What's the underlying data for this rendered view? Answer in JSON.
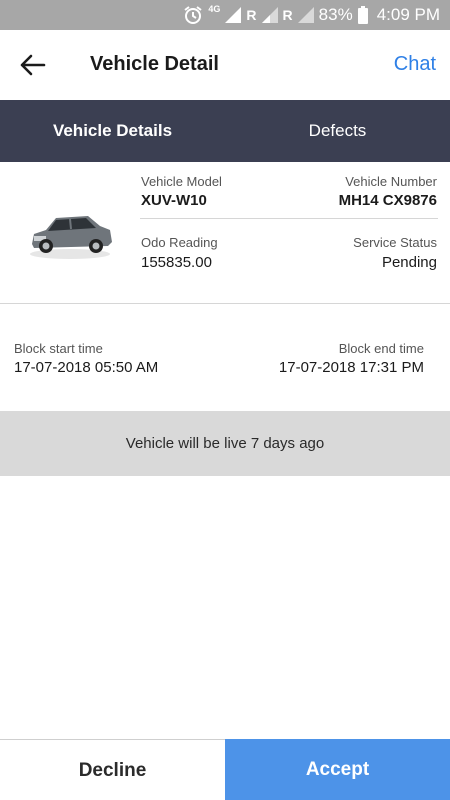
{
  "status_bar": {
    "network": "4G",
    "roaming_1": "R",
    "roaming_2": "R",
    "battery": "83%",
    "time": "4:09 PM"
  },
  "app_bar": {
    "title": "Vehicle Detail",
    "chat_label": "Chat"
  },
  "tabs": [
    {
      "label": "Vehicle Details",
      "active": true
    },
    {
      "label": "Defects",
      "active": false
    }
  ],
  "vehicle": {
    "model_label": "Vehicle Model",
    "model_value": "XUV-W10",
    "number_label": "Vehicle Number",
    "number_value": "MH14 CX9876",
    "odo_label": "Odo Reading",
    "odo_value": "155835.00",
    "status_label": "Service Status",
    "status_value": "Pending"
  },
  "block": {
    "start_label": "Block start time",
    "start_value": "17-07-2018 05:50 AM",
    "end_label": "Block end time",
    "end_value": "17-07-2018 17:31 PM"
  },
  "live_message": "Vehicle will be live 7 days ago",
  "actions": {
    "decline_label": "Decline",
    "accept_label": "Accept"
  },
  "colors": {
    "status_bar": "#a7a7a7",
    "tab_bar": "#3b3f52",
    "accent_blue": "#2f80e6",
    "accept_button": "#4d93e8",
    "banner": "#d9d9d9"
  }
}
